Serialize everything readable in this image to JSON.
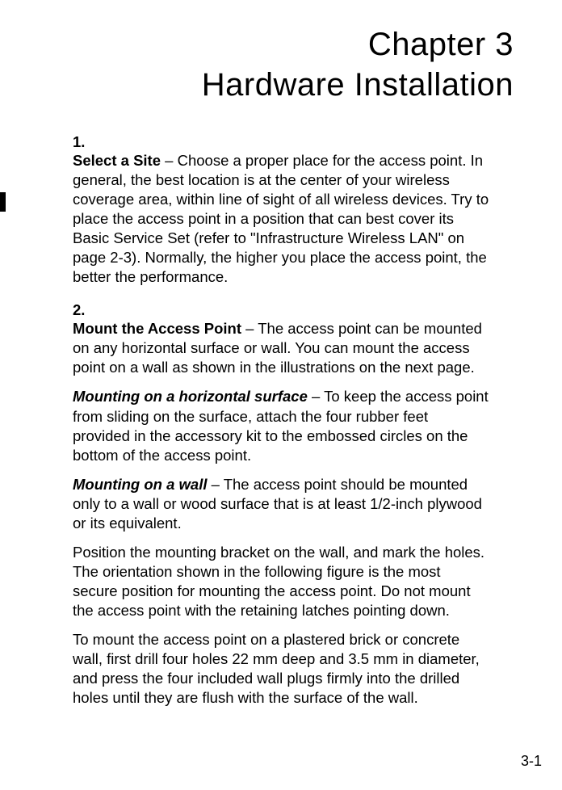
{
  "chapter": {
    "line1": "Chapter 3",
    "line2": "Hardware Installation"
  },
  "items": [
    {
      "number": "1.",
      "title": "Select a Site",
      "sep": " – ",
      "text": "Choose a proper place for the access point. In general, the best location is at the center of your wireless coverage area, within line of sight of all wireless devices. Try to place the access point in a position that can best cover its Basic Service Set (refer to \"Infrastructure Wireless LAN\" on page 2-3). Normally, the higher you place the access point, the better the performance.",
      "subs": []
    },
    {
      "number": "2.",
      "title": "Mount the Access Point",
      "sep": " – ",
      "text": "The access point can be mounted on any horizontal surface or wall. You can mount the access point on a wall as shown in the illustrations on the next page.",
      "subs": [
        {
          "title": "Mounting on a horizontal surface",
          "sep": " – ",
          "text": "To keep the access point from sliding on the surface, attach the four rubber feet provided in the accessory kit to the embossed circles on the bottom of the access point."
        },
        {
          "title": "Mounting on a wall",
          "sep": " – ",
          "text": "The access point should be mounted only to a wall or wood surface that is at least 1/2-inch plywood or its equivalent."
        },
        {
          "title": "",
          "sep": "",
          "text": "Position the mounting bracket on the wall, and mark the holes. The orientation shown in the following figure is the most secure position for mounting the access point. Do not mount the access point with the retaining latches pointing down."
        },
        {
          "title": "",
          "sep": "",
          "text": "To mount the access point on a plastered brick or concrete wall, first drill four holes 22 mm deep and 3.5 mm in diameter, and press the four included wall plugs firmly into the drilled holes until they are flush with the surface of the wall."
        }
      ]
    }
  ],
  "page_number": "3-1"
}
